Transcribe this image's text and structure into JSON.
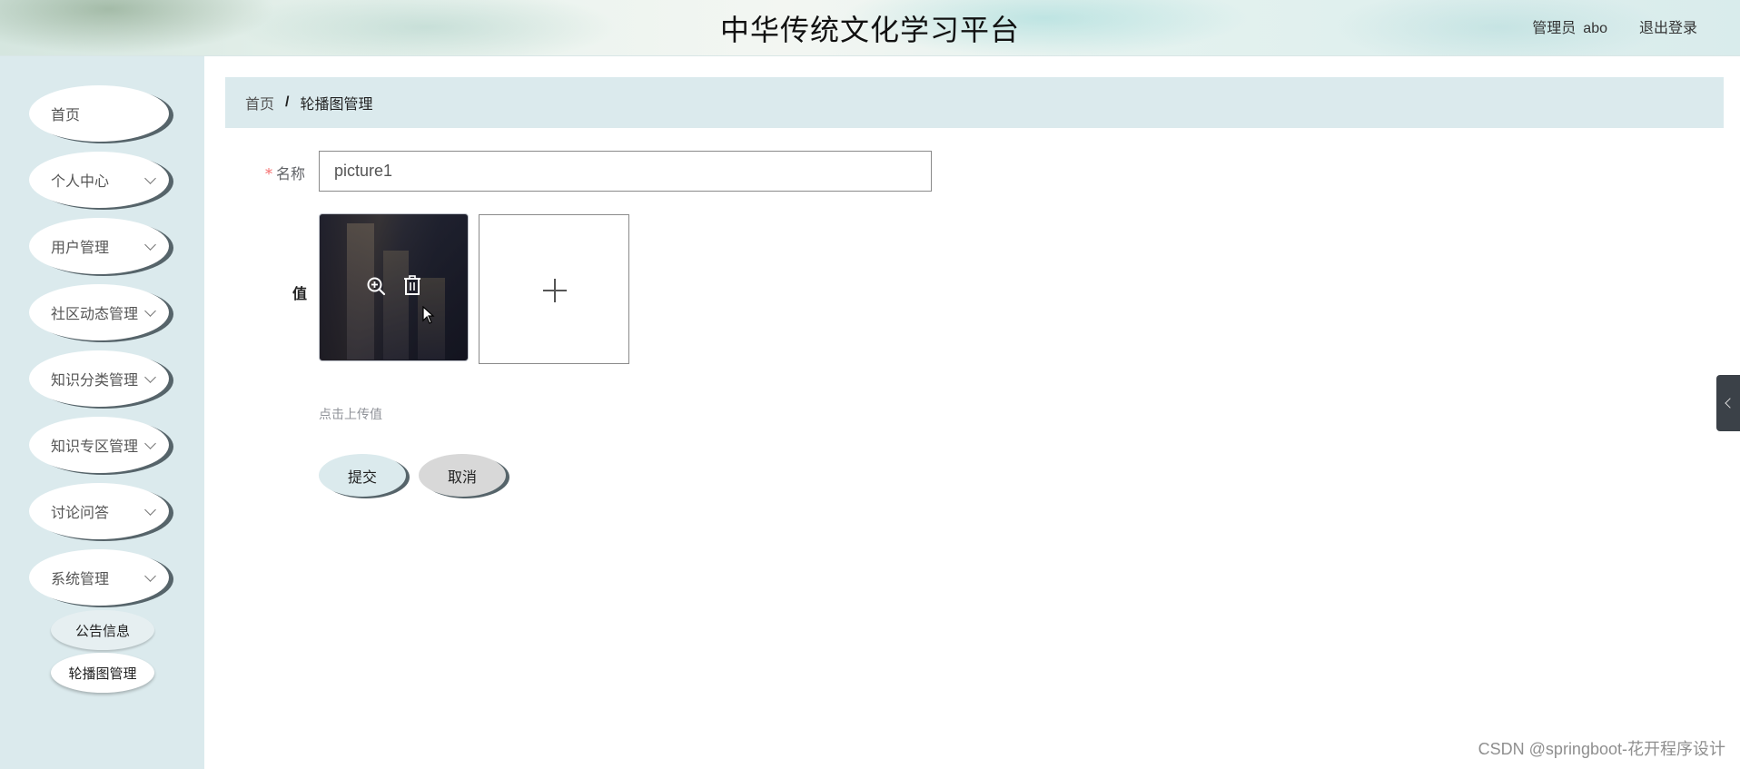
{
  "header": {
    "title": "中华传统文化学习平台",
    "role_label": "管理员",
    "username": "abo",
    "logout_label": "退出登录"
  },
  "sidebar": {
    "items": [
      {
        "label": "首页",
        "has_submenu": false
      },
      {
        "label": "个人中心",
        "has_submenu": true
      },
      {
        "label": "用户管理",
        "has_submenu": true
      },
      {
        "label": "社区动态管理",
        "has_submenu": true
      },
      {
        "label": "知识分类管理",
        "has_submenu": true
      },
      {
        "label": "知识专区管理",
        "has_submenu": true
      },
      {
        "label": "讨论问答",
        "has_submenu": true
      },
      {
        "label": "系统管理",
        "has_submenu": true
      }
    ],
    "subitems": [
      {
        "label": "公告信息",
        "active": false
      },
      {
        "label": "轮播图管理",
        "active": true
      }
    ]
  },
  "breadcrumb": {
    "home": "首页",
    "separator": "/",
    "current": "轮播图管理"
  },
  "form": {
    "name_label": "名称",
    "required_mark": "*",
    "name_value": "picture1",
    "value_label": "值",
    "upload_hint": "点击上传值",
    "submit_label": "提交",
    "cancel_label": "取消"
  },
  "icons": {
    "zoom": "zoom-in-icon",
    "delete": "trash-icon",
    "upload": "plus-icon",
    "side_tab": "chevron-left-icon"
  },
  "colors": {
    "sidebar_bg": "#dbeaed",
    "menu_shadow": "#56646a",
    "required": "#f56c6c"
  },
  "watermark": "CSDN @springboot-花开程序设计"
}
